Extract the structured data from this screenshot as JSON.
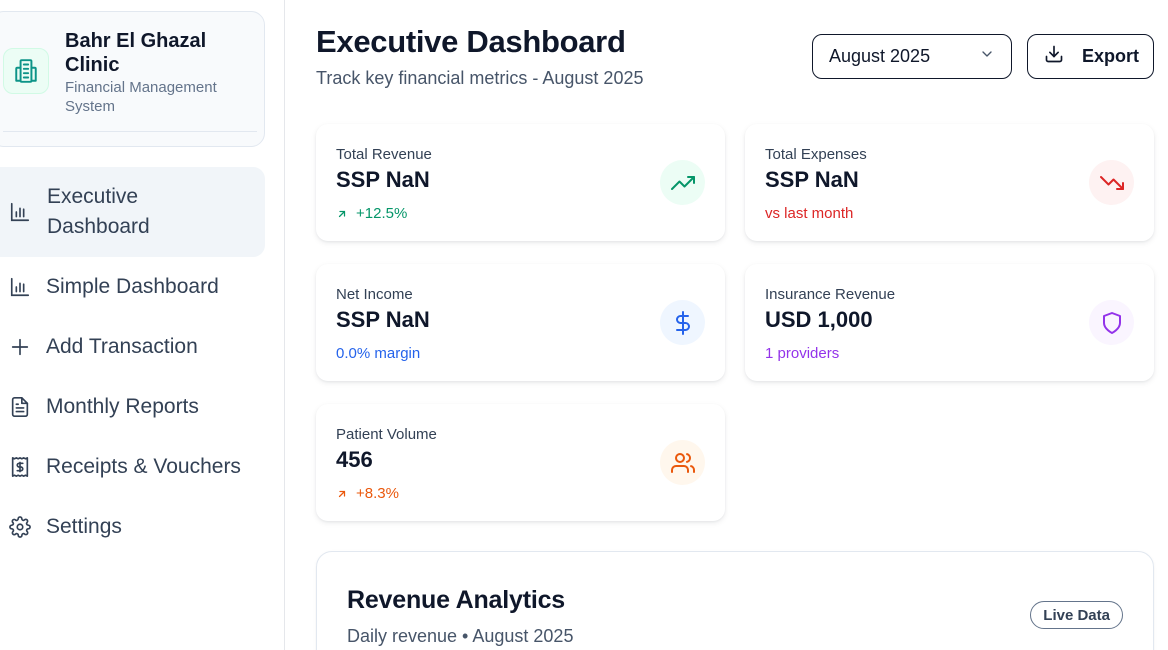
{
  "brand": {
    "name": "Bahr El Ghazal Clinic",
    "subtitle": "Financial Management System",
    "accent": "#0d9488"
  },
  "nav": {
    "items": [
      {
        "label": "Executive Dashboard",
        "icon": "bar-chart-icon",
        "active": true
      },
      {
        "label": "Simple Dashboard",
        "icon": "bar-chart-icon",
        "active": false
      },
      {
        "label": "Add Transaction",
        "icon": "plus-icon",
        "active": false
      },
      {
        "label": "Monthly Reports",
        "icon": "document-icon",
        "active": false
      },
      {
        "label": "Receipts & Vouchers",
        "icon": "receipt-icon",
        "active": false
      },
      {
        "label": "Settings",
        "icon": "gear-icon",
        "active": false
      }
    ]
  },
  "header": {
    "title": "Executive Dashboard",
    "subtitle": "Track key financial metrics - August 2025",
    "month_selected": "August 2025",
    "export_label": "Export"
  },
  "kpis": {
    "revenue": {
      "label": "Total Revenue",
      "value": "SSP NaN",
      "foot": "+12.5%",
      "color": "#059669",
      "icon": "trending-up-icon"
    },
    "expenses": {
      "label": "Total Expenses",
      "value": "SSP NaN",
      "foot": "vs last month",
      "color": "#dc2626",
      "icon": "trending-down-icon"
    },
    "net": {
      "label": "Net Income",
      "value": "SSP NaN",
      "foot": "0.0% margin",
      "color": "#2563eb",
      "icon": "dollar-icon"
    },
    "insurance": {
      "label": "Insurance Revenue",
      "value": "USD 1,000",
      "foot": "1 providers",
      "color": "#9333ea",
      "icon": "shield-icon"
    },
    "patients": {
      "label": "Patient Volume",
      "value": "456",
      "foot": "+8.3%",
      "color": "#ea580c",
      "icon": "users-icon"
    }
  },
  "analytics": {
    "title": "Revenue Analytics",
    "subtitle": "Daily revenue • August 2025",
    "badge": "Live Data"
  }
}
